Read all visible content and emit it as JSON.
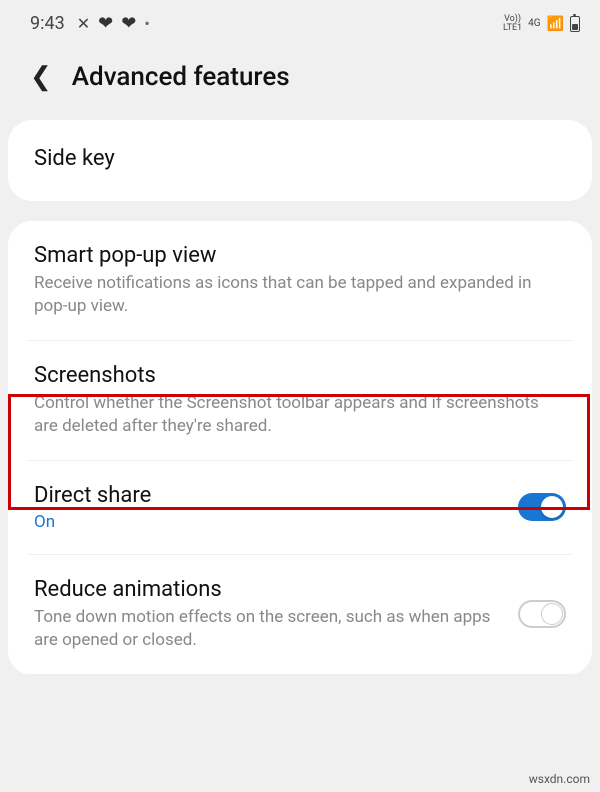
{
  "status": {
    "time": "9:43",
    "net1": "Vo))",
    "net2": "LTE1",
    "net3": "4G"
  },
  "header": {
    "title": "Advanced features"
  },
  "sidekey": {
    "title": "Side key"
  },
  "items": {
    "smartpopup": {
      "title": "Smart pop-up view",
      "desc": "Receive notifications as icons that can be tapped and expanded in pop-up view."
    },
    "screenshots": {
      "title": "Screenshots",
      "desc": "Control whether the Screenshot toolbar appears and if screenshots are deleted after they're shared."
    },
    "directshare": {
      "title": "Direct share",
      "sub": "On"
    },
    "reduceanim": {
      "title": "Reduce animations",
      "desc": "Tone down motion effects on the screen, such as when apps are opened or closed."
    }
  },
  "watermark": "wsxdn.com"
}
